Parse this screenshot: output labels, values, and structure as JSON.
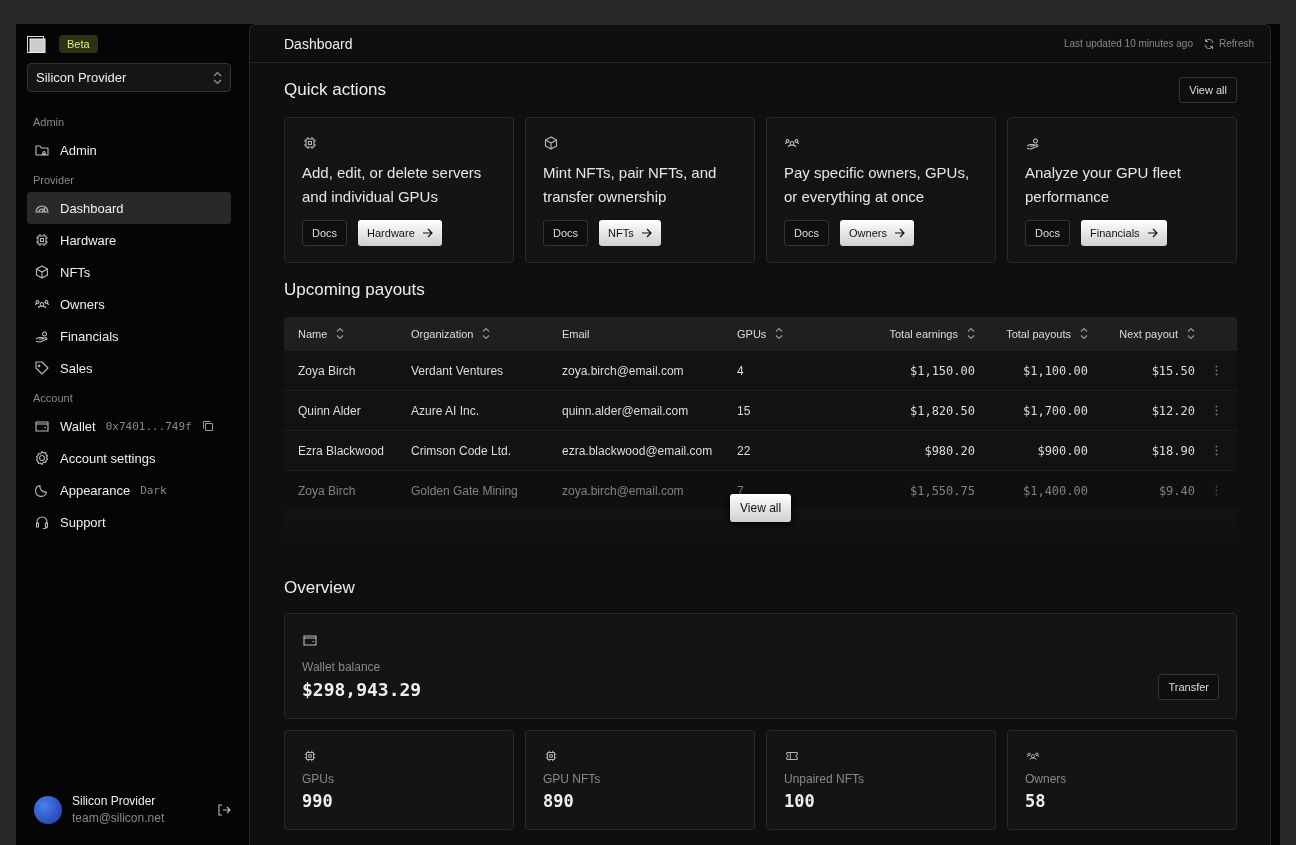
{
  "sidebar": {
    "badge": "Beta",
    "org_select": "Silicon Provider",
    "sections": [
      {
        "title": "Admin",
        "items": [
          {
            "kind": "admin",
            "label": "Admin",
            "selected": false
          }
        ]
      },
      {
        "title": "Provider",
        "items": [
          {
            "kind": "dashboard",
            "label": "Dashboard",
            "selected": true
          },
          {
            "kind": "hardware",
            "label": "Hardware",
            "selected": false
          },
          {
            "kind": "nfts",
            "label": "NFTs",
            "selected": false
          },
          {
            "kind": "owners",
            "label": "Owners",
            "selected": false
          },
          {
            "kind": "financials",
            "label": "Financials",
            "selected": false
          },
          {
            "kind": "sales",
            "label": "Sales",
            "selected": false
          }
        ]
      },
      {
        "title": "Account",
        "items": [
          {
            "kind": "wallet",
            "label": "Wallet",
            "value": "0x7401...749f",
            "selected": false
          },
          {
            "kind": "settings",
            "label": "Account settings",
            "selected": false
          },
          {
            "kind": "appearance",
            "label": "Appearance",
            "value": "Dark",
            "selected": false
          },
          {
            "kind": "support",
            "label": "Support",
            "selected": false
          }
        ]
      }
    ],
    "user": {
      "name": "Silicon Provider",
      "email": "team@silicon.net"
    }
  },
  "header": {
    "title": "Dashboard",
    "updated": "Last updated 10 minutes ago",
    "refresh": "Refresh"
  },
  "quick_actions": {
    "title": "Quick actions",
    "view_all": "View all",
    "cards": [
      {
        "kind": "hardware",
        "text": "Add, edit, or delete servers and individual GPUs",
        "docs": "Docs",
        "action": "Hardware"
      },
      {
        "kind": "nfts",
        "text": "Mint NFTs, pair NFTs, and transfer ownership",
        "docs": "Docs",
        "action": "NFTs"
      },
      {
        "kind": "owners",
        "text": "Pay specific owners, GPUs, or everything at once",
        "docs": "Docs",
        "action": "Owners"
      },
      {
        "kind": "financials",
        "text": "Analyze your GPU fleet performance",
        "docs": "Docs",
        "action": "Financials"
      }
    ]
  },
  "payouts": {
    "title": "Upcoming payouts",
    "columns": [
      {
        "label": "Name",
        "sortable": true
      },
      {
        "label": "Organization",
        "sortable": true
      },
      {
        "label": "Email",
        "sortable": false
      },
      {
        "label": "GPUs",
        "sortable": true
      },
      {
        "label": "Total earnings",
        "sortable": true
      },
      {
        "label": "Total payouts",
        "sortable": true
      },
      {
        "label": "Next payout",
        "sortable": true
      }
    ],
    "rows": [
      {
        "kind": "normal",
        "cells": [
          "Zoya Birch",
          "Verdant Ventures",
          "zoya.birch@email.com",
          "4",
          "$1,150.00",
          "$1,100.00",
          "$15.50"
        ]
      },
      {
        "kind": "normal",
        "cells": [
          "Quinn Alder",
          "Azure AI Inc.",
          "quinn.alder@email.com",
          "15",
          "$1,820.50",
          "$1,700.00",
          "$12.20"
        ]
      },
      {
        "kind": "normal",
        "cells": [
          "Ezra Blackwood",
          "Crimson Code Ltd.",
          "ezra.blackwood@email.com",
          "22",
          "$980.20",
          "$900.00",
          "$18.90"
        ]
      },
      {
        "kind": "dim",
        "cells": [
          "Zoya Birch",
          "Golden Gate Mining",
          "zoya.birch@email.com",
          "7",
          "$1,550.75",
          "$1,400.00",
          "$9.40"
        ]
      }
    ],
    "view_all": "View all"
  },
  "overview": {
    "title": "Overview",
    "wallet": {
      "label": "Wallet balance",
      "value": "$298,943.29",
      "button": "Transfer"
    },
    "stats": [
      {
        "kind": "gpus",
        "label": "GPUs",
        "value": "990"
      },
      {
        "kind": "gpu_nfts",
        "label": "GPU NFTs",
        "value": "890"
      },
      {
        "kind": "unpaired",
        "label": "Unpaired NFTs",
        "value": "100"
      },
      {
        "kind": "owners",
        "label": "Owners",
        "value": "58"
      }
    ]
  }
}
